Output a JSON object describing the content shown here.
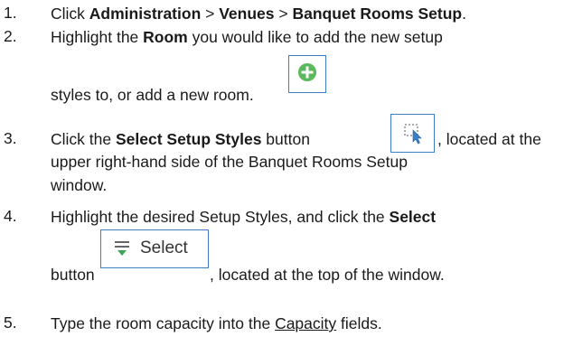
{
  "steps": [
    {
      "number": "1.",
      "t1": "Click ",
      "b1": "Administration",
      "t2": " > ",
      "b2": "Venues",
      "t3": " > ",
      "b3": "Banquet Rooms Setup",
      "t4": "."
    },
    {
      "number": "2.",
      "t1": "Highlight the ",
      "b1": "Room",
      "t2": " you would like to add the new setup",
      "t3": "styles to, or add a new room.",
      "icon": "add-green-circle-icon"
    },
    {
      "number": "3.",
      "t1": "Click the ",
      "b1": "Select Setup Styles",
      "t2": " button",
      "t3": ", located at the",
      "t4": "upper right-hand side of the Banquet Rooms Setup",
      "t5": "window.",
      "icon": "select-area-cursor-icon"
    },
    {
      "number": "4.",
      "t1": "Highlight the desired Setup Styles, and click the ",
      "b1": "Select",
      "t2": "button",
      "t3": ", located at the top of the window.",
      "button_label": "Select",
      "icon": "select-filter-icon"
    },
    {
      "number": "5.",
      "t1": "Type the room capacity into the ",
      "u1": "Capacity",
      "t2": " fields."
    }
  ],
  "colors": {
    "icon_border": "#3a7fc8",
    "add_icon_green": "#5cb85c",
    "filter_icon_green": "#3aa655"
  }
}
